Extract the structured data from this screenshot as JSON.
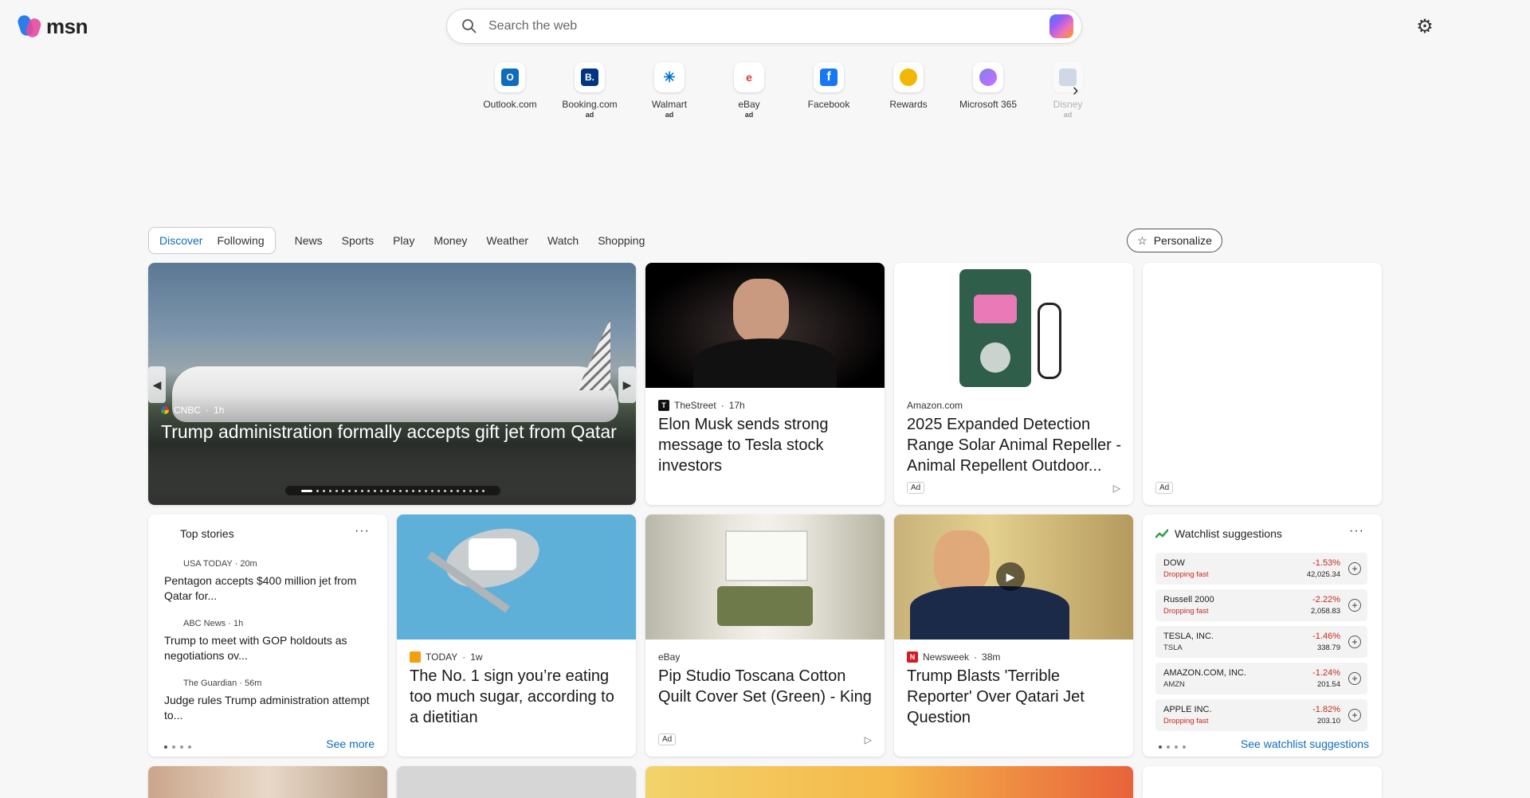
{
  "header": {
    "logo_text": "msn",
    "search_placeholder": "Search the web"
  },
  "shortcuts": [
    {
      "label": "Outlook.com",
      "ad": "",
      "color": "#0f6cbd",
      "glyph": "O"
    },
    {
      "label": "Booking.com",
      "ad": "ad",
      "color": "#003580",
      "glyph": "B."
    },
    {
      "label": "Walmart",
      "ad": "ad",
      "color": "#0071ce",
      "glyph": "✳"
    },
    {
      "label": "eBay",
      "ad": "ad",
      "color": "#f5af02",
      "glyph": "e"
    },
    {
      "label": "Facebook",
      "ad": "",
      "color": "#1877f2",
      "glyph": "f"
    },
    {
      "label": "Rewards",
      "ad": "",
      "color": "#f2b705",
      "glyph": "🏆"
    },
    {
      "label": "Microsoft 365",
      "ad": "",
      "color": "#7b83eb",
      "glyph": "◎"
    },
    {
      "label": "Disney",
      "ad": "ad",
      "color": "#8aa0c8",
      "glyph": "D"
    }
  ],
  "nav": {
    "pill": [
      "Discover",
      "Following"
    ],
    "links": [
      "News",
      "Sports",
      "Play",
      "Money",
      "Weather",
      "Watch",
      "Shopping"
    ],
    "personalize": "Personalize"
  },
  "hero": {
    "source": "CNBC",
    "time": "1h",
    "title": "Trump administration formally accepts gift jet from Qatar"
  },
  "stories": [
    {
      "source": "TheStreet",
      "time": "17h",
      "title": "Elon Musk sends strong message to Tesla stock investors",
      "ad": false
    },
    {
      "source": "Amazon.com",
      "time": "",
      "title": "2025 Expanded Detection Range Solar Animal Repeller - Animal Repellent Outdoor...",
      "ad": true
    },
    {
      "source": "TODAY",
      "time": "1w",
      "title": "The No. 1 sign you’re eating too much sugar, according to a dietitian",
      "ad": false
    },
    {
      "source": "eBay",
      "time": "",
      "title": "Pip Studio Toscana Cotton Quilt Cover Set (Green) - King",
      "ad": true
    },
    {
      "source": "Newsweek",
      "time": "38m",
      "title": "Trump Blasts 'Terrible Reporter' Over Qatari Jet Question",
      "ad": false
    }
  ],
  "ad_label": "Ad",
  "top_stories": {
    "title": "Top stories",
    "items": [
      {
        "source": "USA TODAY · 20m",
        "title": "Pentagon accepts $400 million jet from Qatar for..."
      },
      {
        "source": "ABC News · 1h",
        "title": "Trump to meet with GOP holdouts as negotiations ov..."
      },
      {
        "source": "The Guardian · 56m",
        "title": "Judge rules Trump administration attempt to..."
      }
    ],
    "see_more": "See more"
  },
  "watchlist": {
    "title": "Watchlist suggestions",
    "rows": [
      {
        "name": "DOW",
        "sub": "Dropping fast",
        "pct": "-1.53%",
        "value": "42,025.34",
        "dropping": true
      },
      {
        "name": "Russell 2000",
        "sub": "Dropping fast",
        "pct": "-2.22%",
        "value": "2,058.83",
        "dropping": true
      },
      {
        "name": "TESLA, INC.",
        "sub": "TSLA",
        "pct": "-1.46%",
        "value": "338.79",
        "dropping": false
      },
      {
        "name": "AMAZON.COM, INC.",
        "sub": "AMZN",
        "pct": "-1.24%",
        "value": "201.54",
        "dropping": false
      },
      {
        "name": "APPLE INC.",
        "sub": "Dropping fast",
        "pct": "-1.82%",
        "value": "203.10",
        "dropping": true
      }
    ],
    "see_link": "See watchlist suggestions"
  },
  "colors": {
    "accent": "#0f6cbd",
    "negative": "#c42b1c"
  }
}
